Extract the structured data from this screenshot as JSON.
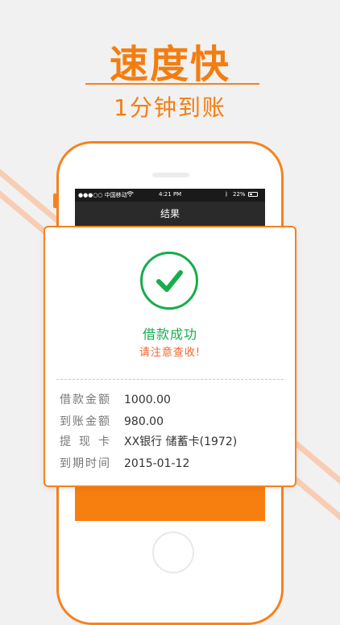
{
  "header": {
    "title": "速度快",
    "subtitle": "1分钟到账"
  },
  "phone_status": {
    "carrier": "●●●○○ 中国移动",
    "time": "4:21 PM",
    "battery": "22%"
  },
  "screen_title": "结果",
  "result": {
    "title": "借款成功",
    "notice": "请注意查收!",
    "rows": [
      {
        "label": "借款金额",
        "value": "1000.00"
      },
      {
        "label": "到账金额",
        "value": "980.00"
      },
      {
        "label": "提现卡",
        "value": "XX银行 储蓄卡(1972)"
      },
      {
        "label": "到期时间",
        "value": "2015-01-12"
      }
    ]
  },
  "colors": {
    "accent": "#f47d10",
    "success": "#17ad4c",
    "notice": "#f0642a"
  },
  "icons": {
    "result": "check-circle-icon",
    "wifi": "wifi-icon",
    "bluetooth": "bluetooth-icon",
    "battery": "battery-icon"
  }
}
